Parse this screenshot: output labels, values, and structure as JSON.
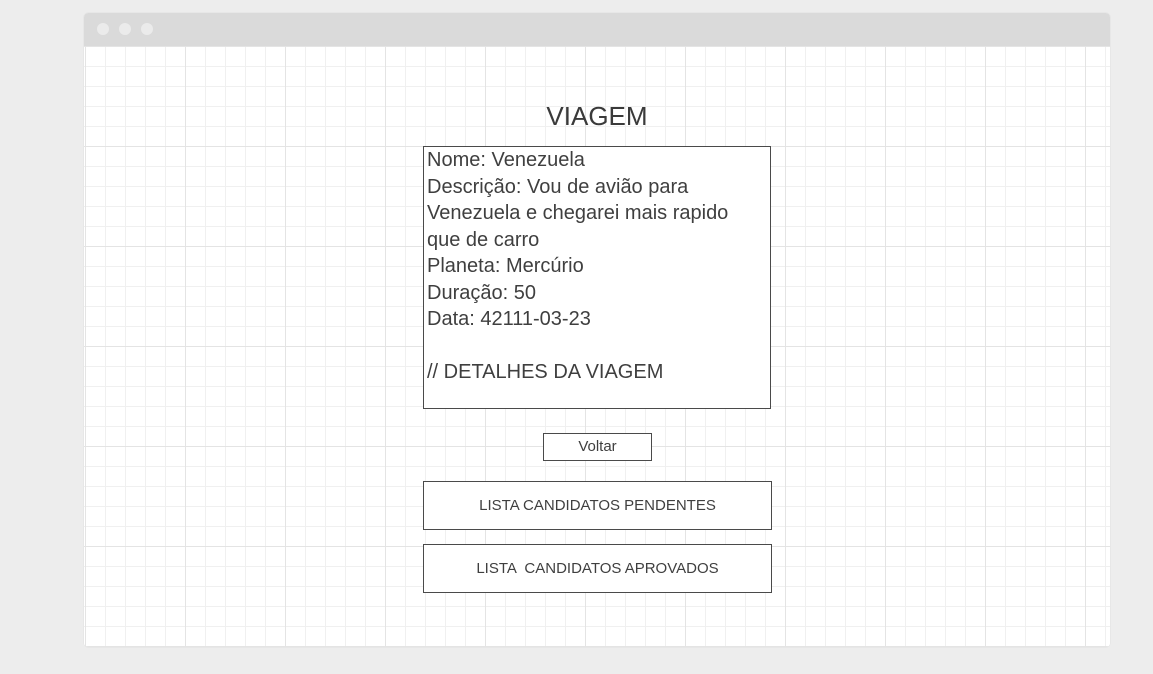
{
  "page": {
    "title": "VIAGEM"
  },
  "details": {
    "lines": [
      "Nome: Venezuela",
      "Descrição: Vou de avião para",
      "Venezuela e chegarei mais rapido",
      "que de carro",
      "Planeta: Mercúrio",
      "Duração: 50",
      "Data: 42111-03-23"
    ],
    "note": "// DETALHES DA VIAGEM"
  },
  "buttons": {
    "back_label": "Voltar",
    "pending_label": "LISTA CANDIDATOS PENDENTES",
    "approved_label": "LISTA  CANDIDATOS APROVADOS"
  }
}
